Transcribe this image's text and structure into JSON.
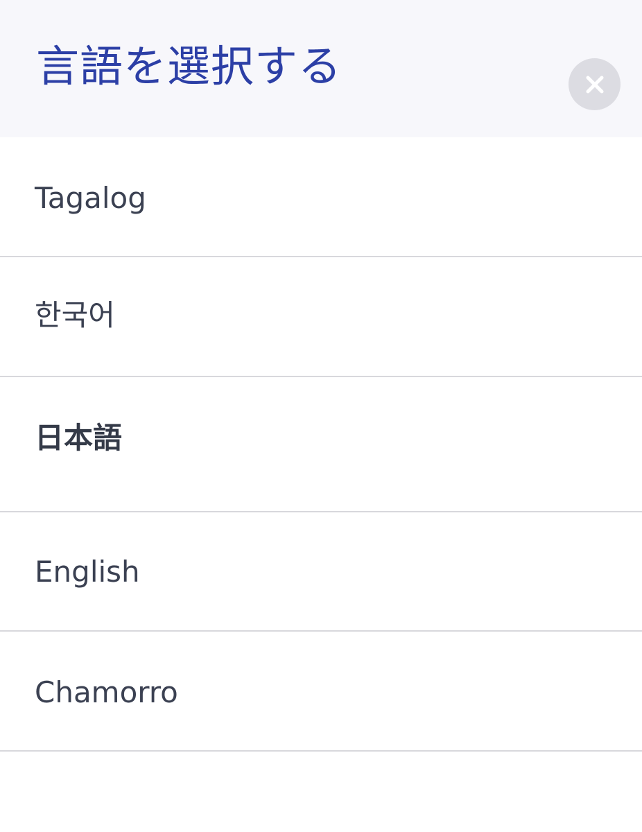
{
  "header": {
    "title": "言語を選択する",
    "close_icon": "close-icon"
  },
  "languages": [
    {
      "label": "Tagalog",
      "selected": false
    },
    {
      "label": "한국어",
      "selected": false
    },
    {
      "label": "日本語",
      "selected": true
    },
    {
      "label": "English",
      "selected": false
    },
    {
      "label": "Chamorro",
      "selected": false
    }
  ],
  "colors": {
    "title": "#2c3fa6",
    "header_bg": "#f7f7fb",
    "close_bg": "#dcdce2",
    "item_text": "#3b4152",
    "divider": "#d8d8dc"
  }
}
